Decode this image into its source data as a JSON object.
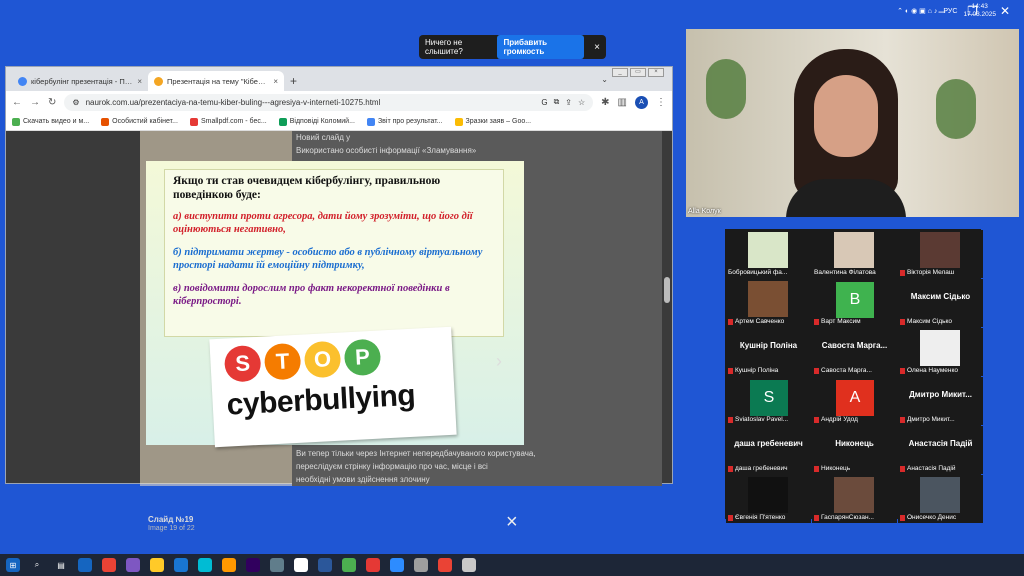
{
  "toast": {
    "message": "Ничего не слышите?",
    "button": "Прибавить громкость",
    "close": "×"
  },
  "browser": {
    "tabs": [
      {
        "title": "кібербулінг презентація - Пошу",
        "active": false,
        "color": "#4285f4"
      },
      {
        "title": "Презентація на тему \"Кібер-бул",
        "active": true,
        "color": "#f4a623"
      }
    ],
    "new_tab": "+",
    "url": "naurok.com.ua/prezentaciya-na-temu-kiber-buling---agresiya-v-interneti-10275.html",
    "avatar_letter": "A",
    "bookmarks": [
      {
        "label": "Скачать видео и м...",
        "color": "#4caf50"
      },
      {
        "label": "Особистий кабінет...",
        "color": "#e65100"
      },
      {
        "label": "Smallpdf.com - бес...",
        "color": "#e53935"
      },
      {
        "label": "Відповіді Коломий...",
        "color": "#0f9d58"
      },
      {
        "label": "Звіт про результат...",
        "color": "#4285f4"
      },
      {
        "label": "Зразки заяв – Goo...",
        "color": "#fbbc04"
      }
    ]
  },
  "page": {
    "bg_lines": [
      "Новий слайд у",
      "Використано особисті інформації «Зламування»",
      "Ви тепер тільки через Інтернет непередбачуваного користувача,",
      "переслідуєм стрінку інформацію про час, місце і всі",
      "необхідні умови здійснення злочину"
    ],
    "slide": {
      "heading": "Якщо ти став очевидцем кібербулінгу, правильною поведінкою буде:",
      "a": "а) виступити проти агресора, дати йому зрозуміти, що його дії оцінюються негативно,",
      "b": "б) підтримати жертву - особисто або в публічному віртуальному просторі надати їй емоційну підтримку,",
      "c": "в) повідомити дорослим про факт некоректної поведінки в кіберпросторі.",
      "stop_letters": [
        "S",
        "T",
        "O",
        "P"
      ],
      "stop_colors": [
        "#e53935",
        "#f57c00",
        "#fbc02d",
        "#4caf50"
      ],
      "cyber": "cyberbullying"
    },
    "slide_number": "Слайд №19",
    "image_count": "Image 19 of 22",
    "next_arrow": "›",
    "close": "×"
  },
  "video": {
    "main_name": "Alla Kолyк",
    "tiles": [
      {
        "label": "Бобровицький фа...",
        "type": "pic",
        "color": "#d9e6c8",
        "muted": false
      },
      {
        "label": "Валентина Філатова",
        "type": "pic",
        "color": "#d8c8b6",
        "muted": false
      },
      {
        "label": "Вікторія Мелаш",
        "type": "pic",
        "color": "#5b3a33",
        "muted": true
      },
      {
        "label": "Артем Савченко",
        "type": "pic",
        "color": "#7a4f33",
        "muted": true
      },
      {
        "label": "Варт Максим",
        "type": "avatar",
        "letter": "B",
        "color": "#3fb34f",
        "muted": true
      },
      {
        "label": "Максим Сідько",
        "type": "name",
        "big": "Максим Сідько",
        "muted": true
      },
      {
        "label": "Кушнір Поліна",
        "type": "name",
        "big": "Кушнір Поліна",
        "muted": true
      },
      {
        "label": "Савоста Марга...",
        "type": "name",
        "big": "Савоста Марга...",
        "muted": true
      },
      {
        "label": "Олена Науменко",
        "type": "pic",
        "color": "#eeeeee",
        "muted": true
      },
      {
        "label": "Sviatoslav Pavel...",
        "type": "avatar",
        "letter": "S",
        "color": "#0b7a52",
        "muted": true
      },
      {
        "label": "Андрій Удод",
        "type": "avatar",
        "letter": "A",
        "color": "#e0301e",
        "muted": true
      },
      {
        "label": "Дмитро Микит...",
        "type": "name",
        "big": "Дмитро Микит...",
        "muted": true
      },
      {
        "label": "даша гребеневич",
        "type": "name",
        "big": "даша гребеневич",
        "muted": true
      },
      {
        "label": "Никонець",
        "type": "name",
        "big": "Никонець",
        "muted": true
      },
      {
        "label": "Анастасія Падій",
        "type": "name",
        "big": "Анастасія Падій",
        "muted": true
      },
      {
        "label": "Євгенія П'ятенко",
        "type": "pic",
        "color": "#111111",
        "muted": true
      },
      {
        "label": "ГаспарянСюзан...",
        "type": "pic",
        "color": "#6b4b3c",
        "muted": true
      },
      {
        "label": "Онисечко Денис",
        "type": "pic",
        "color": "#4b5560",
        "muted": true
      }
    ]
  },
  "taskbar": {
    "time": "14:43",
    "date": "17.03.2025",
    "lang": "РУС",
    "apps": [
      "#1565c0",
      "#ea4335",
      "#7e57c2",
      "#ffca28",
      "#1976d2",
      "#00bcd4",
      "#ff9800",
      "#31005e",
      "#607d8b",
      "#ffffff",
      "#2b579a",
      "#4caf50",
      "#e53935",
      "#2d8cff",
      "#9e9e9e",
      "#ea4335",
      "#c8c8c8"
    ]
  }
}
